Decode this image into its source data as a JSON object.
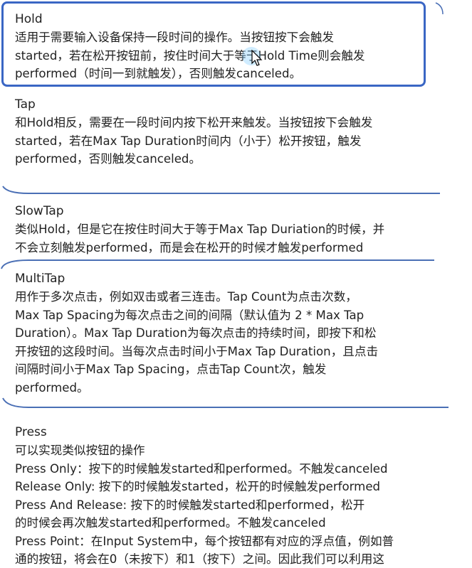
{
  "hold": {
    "title": "Hold",
    "lines": [
      "适用于需要输入设备保持一段时间的操作。当按钮按下会触发",
      "started，若在松开按钮前，按住时间大于等于Hold Time则会触发",
      "performed（时间一到就触发），否则触发canceled。"
    ]
  },
  "tap": {
    "title": "Tap",
    "lines": [
      "和Hold相反，需要在一段时间内按下松开来触发。当按钮按下会触发",
      "started，若在Max Tap Duration时间内（小于）松开按钮，触发",
      "performed，否则触发canceled。"
    ]
  },
  "slowtap": {
    "title": "SlowTap",
    "lines": [
      "类似Hold，但是它在按住时间大于等于Max Tap Duriation的时候，并",
      "不会立刻触发performed，而是会在松开的时候才触发performed"
    ]
  },
  "multitap": {
    "title": "MultiTap",
    "lines": [
      "用作于多次点击，例如双击或者三连击。Tap Count为点击次数，",
      "Max Tap Spacing为每次点击之间的间隔（默认值为 2 * Max Tap",
      "Duration）。Max Tap Duration为每次点击的持续时间，即按下和松",
      "开按钮的这段时间。当每次点击时间小于Max Tap Duration，且点击",
      "间隔时间小于Max Tap Spacing，点击Tap Count次，触发",
      "performed。"
    ]
  },
  "press": {
    "title": "Press",
    "lines": [
      "可以实现类似按钮的操作",
      "Press Only：按下的时候触发started和performed。不触发canceled",
      "Release Only:     按下的时候触发started，松开的时候触发performed",
      "Press And Release:          按下的时候触发started和performed，松开",
      "的时候会再次触发started和performed。不触发canceled",
      "Press Point：在Input System中，每个按钮都有对应的浮点值，例如普",
      "通的按钮，将会在0（未按下）和1（按下）之间。因此我们可以利用这"
    ]
  },
  "colors": {
    "highlight_border": "#3a66c4",
    "divider": "#4a6fb5"
  }
}
